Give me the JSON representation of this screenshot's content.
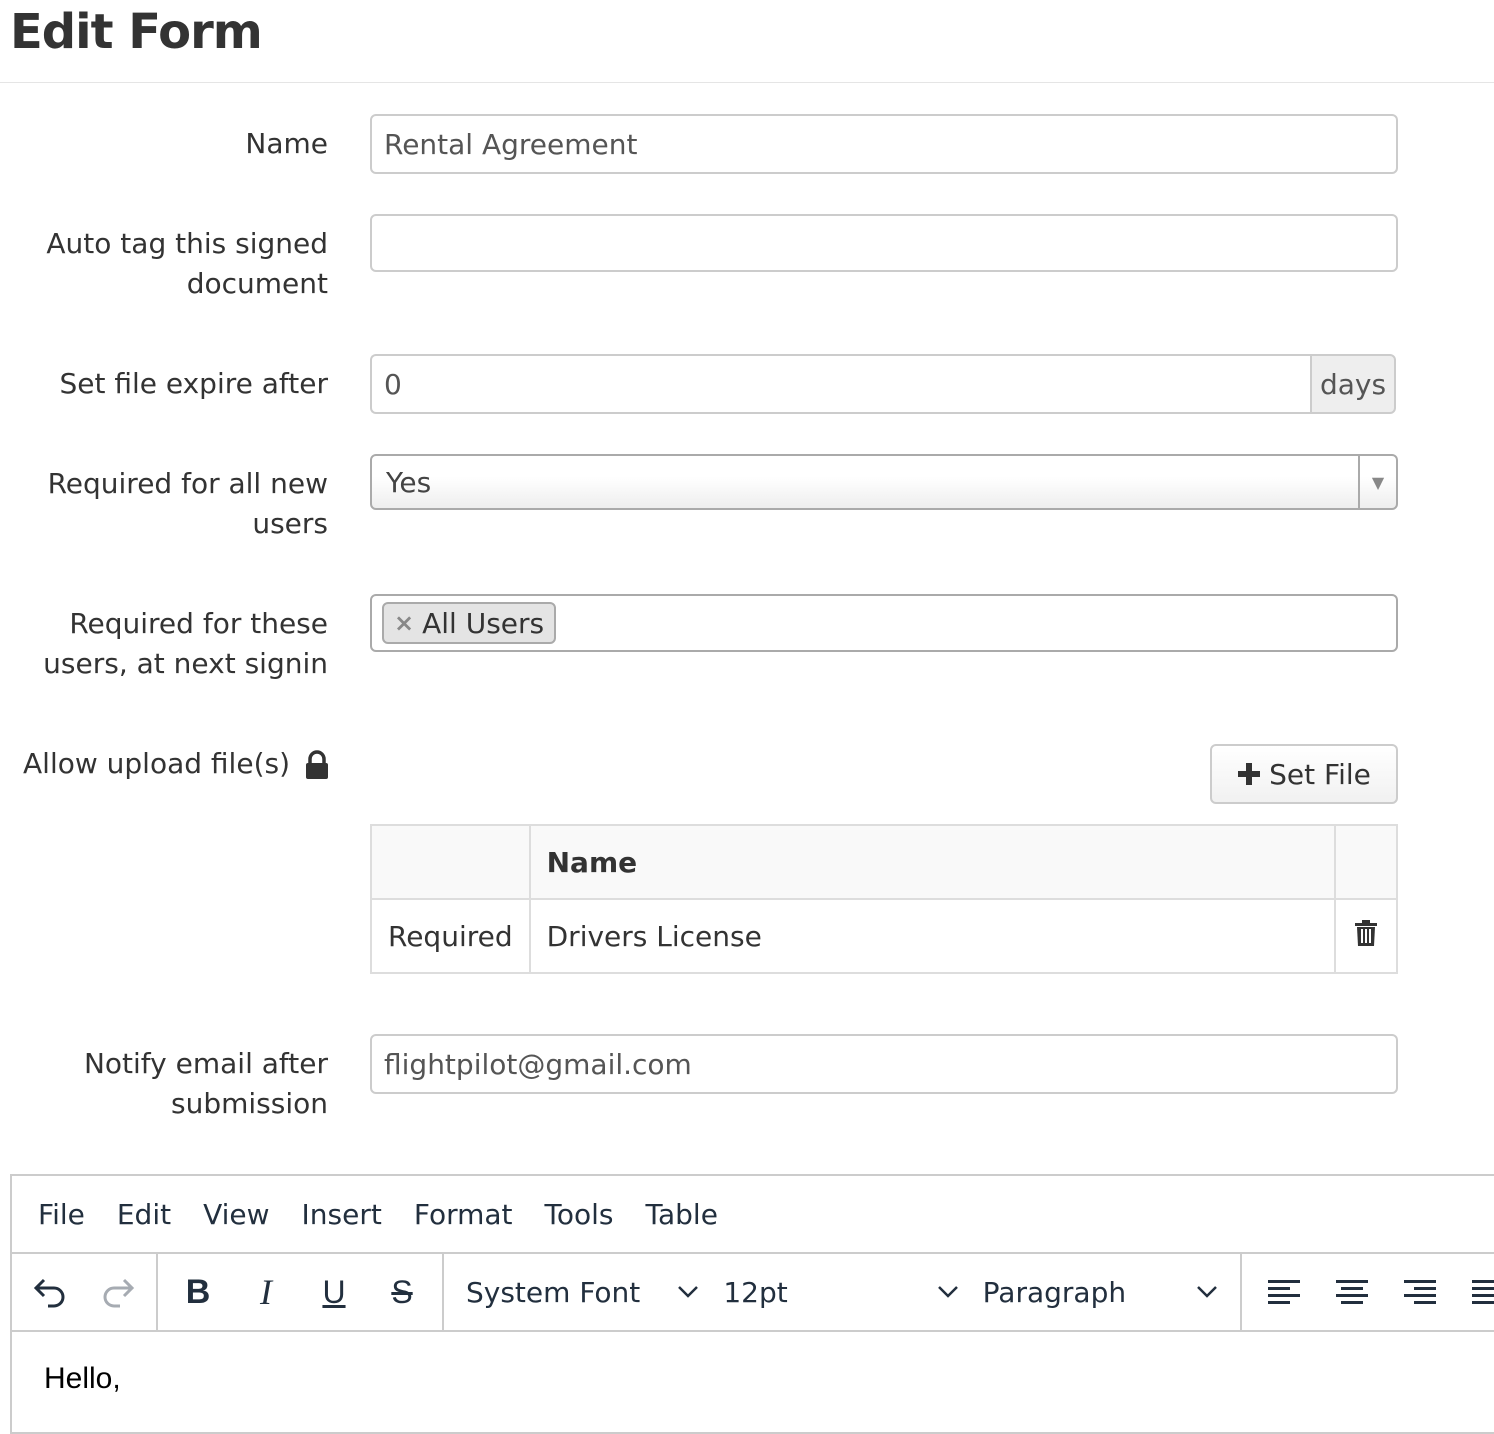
{
  "page": {
    "title": "Edit Form"
  },
  "form": {
    "name": {
      "label": "Name",
      "value": "Rental Agreement"
    },
    "auto_tag": {
      "label": "Auto tag this signed document",
      "value": ""
    },
    "expire": {
      "label": "Set file expire after",
      "value": "0",
      "addon": "days"
    },
    "required_new_users": {
      "label": "Required for all new users",
      "selected": "Yes"
    },
    "required_users": {
      "label": "Required for these users, at next signin",
      "tags": [
        "All Users"
      ]
    },
    "upload": {
      "label": "Allow upload file(s)",
      "lock_icon": "lock-icon",
      "set_file_button": "Set File",
      "table": {
        "headers": [
          "",
          "Name",
          ""
        ],
        "rows": [
          {
            "status": "Required",
            "name": "Drivers License",
            "action_icon": "trash-icon"
          }
        ]
      }
    },
    "notify_email": {
      "label": "Notify email after submission",
      "value": "flightpilot@gmail.com"
    }
  },
  "editor": {
    "menu": [
      "File",
      "Edit",
      "View",
      "Insert",
      "Format",
      "Tools",
      "Table"
    ],
    "font_family": "System Font",
    "font_size": "12pt",
    "block_format": "Paragraph",
    "content": "Hello,"
  }
}
